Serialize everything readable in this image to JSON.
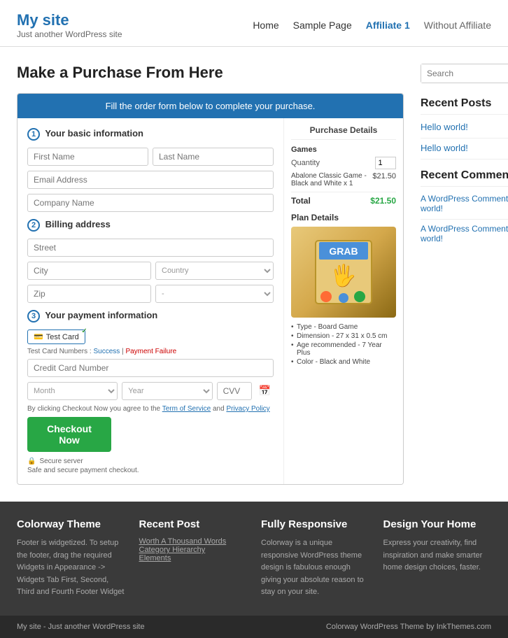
{
  "site": {
    "title": "My site",
    "tagline": "Just another WordPress site"
  },
  "nav": {
    "links": [
      {
        "label": "Home",
        "active": false
      },
      {
        "label": "Sample Page",
        "active": false
      },
      {
        "label": "Affiliate 1",
        "active": true
      },
      {
        "label": "Without Affiliate",
        "active": false
      }
    ]
  },
  "page": {
    "title": "Make a Purchase From Here"
  },
  "checkout": {
    "header": "Fill the order form below to complete your purchase.",
    "section1_title": "Your basic information",
    "firstname_placeholder": "First Name",
    "lastname_placeholder": "Last Name",
    "email_placeholder": "Email Address",
    "company_placeholder": "Company Name",
    "section2_title": "Billing address",
    "street_placeholder": "Street",
    "city_placeholder": "City",
    "country_placeholder": "Country",
    "zip_placeholder": "Zip",
    "section3_title": "Your payment information",
    "card_label": "Test Card",
    "test_card_label": "Test Card Numbers :",
    "test_card_success": "Success",
    "test_card_failure": "Payment Failure",
    "cc_placeholder": "Credit Card Number",
    "month_placeholder": "Month",
    "year_placeholder": "Year",
    "cvv_placeholder": "CVV",
    "terms_text": "By clicking Checkout Now you agree to the",
    "terms_link": "Term of Service",
    "and_text": "and",
    "privacy_link": "Privacy Policy",
    "checkout_btn": "Checkout Now",
    "secure_label": "Secure server",
    "secure_note": "Safe and secure payment checkout."
  },
  "purchase_details": {
    "title": "Purchase Details",
    "category": "Games",
    "quantity_label": "Quantity",
    "quantity_value": "1",
    "product_name": "Abalone Classic Game - Black and White x 1",
    "product_price": "$21.50",
    "total_label": "Total",
    "total_price": "$21.50"
  },
  "plan_details": {
    "title": "Plan Details",
    "specs": [
      "Type - Board Game",
      "Dimension - 27 x 31 x 0.5 cm",
      "Age recommended - 7 Year Plus",
      "Color - Black and White"
    ]
  },
  "sidebar": {
    "search_placeholder": "Search",
    "recent_posts_title": "Recent Posts",
    "posts": [
      {
        "label": "Hello world!"
      },
      {
        "label": "Hello world!"
      }
    ],
    "recent_comments_title": "Recent Comments",
    "comments": [
      {
        "author": "A WordPress Commenter",
        "on": "on",
        "post": "Hello world!"
      },
      {
        "author": "A WordPress Commenter",
        "on": "on",
        "post": "Hello world!"
      }
    ]
  },
  "footer": {
    "cols": [
      {
        "title": "Colorway Theme",
        "text": "Footer is widgetized. To setup the footer, drag the required Widgets in Appearance -> Widgets Tab First, Second, Third and Fourth Footer Widget"
      },
      {
        "title": "Recent Post",
        "links": [
          "Worth A Thousand Words",
          "Category Hierarchy",
          "Elements"
        ]
      },
      {
        "title": "Fully Responsive",
        "text": "Colorway is a unique responsive WordPress theme design is fabulous enough giving your absolute reason to stay on your site."
      },
      {
        "title": "Design Your Home",
        "text": "Express your creativity, find inspiration and make smarter home design choices, faster."
      }
    ],
    "bottom_left": "My site - Just another WordPress site",
    "bottom_right": "Colorway WordPress Theme by InkThemes.com"
  }
}
